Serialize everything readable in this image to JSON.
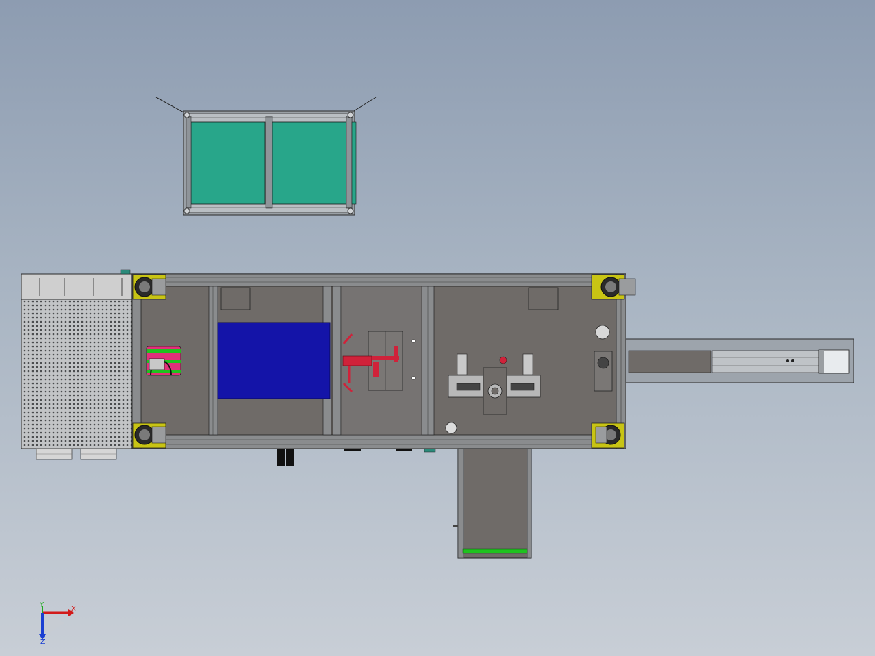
{
  "viewport": {
    "background_top": "#8d9cb1",
    "background_bottom": "#c8ced6"
  },
  "triad": {
    "x_label": "X",
    "y_label": "Y",
    "z_label": "Z",
    "x_color": "#d21a1a",
    "y_color": "#1faa1f",
    "z_color": "#1a3fd2"
  },
  "colors": {
    "glass": "#28a68a",
    "frame": "#6d6e6f",
    "plate": "#6f6b68",
    "blue_block": "#1414a8",
    "red_part": "#d0223a",
    "green_part": "#1fc21f",
    "yellow_bracket": "#c8c414",
    "magenta_part": "#e0307a"
  }
}
